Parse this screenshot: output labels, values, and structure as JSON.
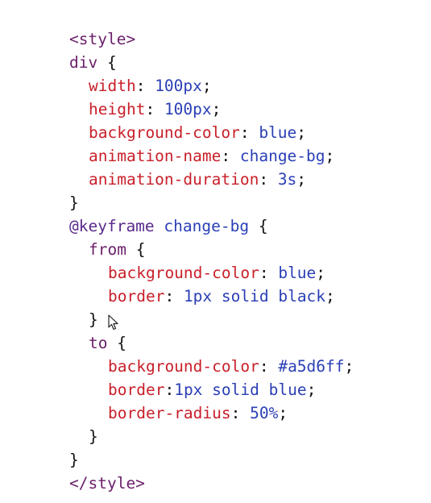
{
  "code": {
    "lines": [
      {
        "open_tag": "<style>"
      },
      {
        "selector": "div",
        "brace": " {"
      },
      {
        "prop": "width",
        "sep": ": ",
        "value": "100px",
        "end": ";"
      },
      {
        "prop": "height",
        "sep": ": ",
        "value": "100px",
        "end": ";"
      },
      {
        "prop": "background-color",
        "sep": ": ",
        "value": "blue",
        "end": ";"
      },
      {
        "prop": "animation-name",
        "sep": ": ",
        "value": "change-bg",
        "end": ";"
      },
      {
        "prop": "animation-duration",
        "sep": ": ",
        "value": "3s",
        "end": ";"
      },
      {
        "brace": "}"
      },
      {
        "keyword": "@keyframe",
        "name": " change-bg",
        "brace": " {"
      },
      {
        "selector": "from",
        "brace": " {"
      },
      {
        "prop": "background-color",
        "sep": ": ",
        "value": "blue",
        "end": ";"
      },
      {
        "prop": "border",
        "sep": ": ",
        "value": "1px solid black",
        "end": ";"
      },
      {
        "brace": "}"
      },
      {
        "selector": "to",
        "brace": " {"
      },
      {
        "prop": "background-color",
        "sep": ": ",
        "value": "#a5d6ff",
        "end": ";"
      },
      {
        "prop": "border",
        "sep": ":",
        "value": "1px solid blue",
        "end": ";"
      },
      {
        "prop": "border-radius",
        "sep": ": ",
        "value": "50%",
        "end": ";"
      },
      {
        "brace": "}"
      },
      {
        "brace": "}"
      },
      {
        "close_tag": "</style>"
      }
    ]
  },
  "cursor": {
    "icon": "mouse-pointer-icon"
  }
}
